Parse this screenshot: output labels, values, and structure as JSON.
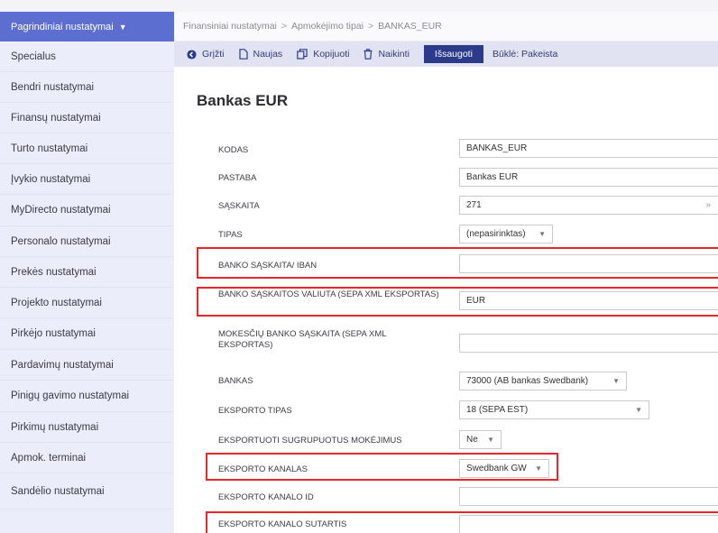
{
  "sidebar": {
    "header": "Pagrindiniai nustatymai",
    "items": [
      {
        "label": "Specialus"
      },
      {
        "label": "Bendri nustatymai"
      },
      {
        "label": "Finansų nustatymai"
      },
      {
        "label": "Turto nustatymai"
      },
      {
        "label": "Įvykio nustatymai"
      },
      {
        "label": "MyDirecto nustatymai"
      },
      {
        "label": "Personalo nustatymai"
      },
      {
        "label": "Prekės nustatymai"
      },
      {
        "label": "Projekto nustatymai"
      },
      {
        "label": "Pirkėjo nustatymai"
      },
      {
        "label": "Pardavimų nustatymai"
      },
      {
        "label": "Pinigų gavimo nustatymai"
      },
      {
        "label": "Pirkimų nustatymai"
      },
      {
        "label": "Apmok. terminai"
      },
      {
        "label": "Sandėlio nustatymai"
      }
    ]
  },
  "breadcrumb": [
    "Finansiniai nustatymai",
    "Apmokėjimo tipai",
    "BANKAS_EUR"
  ],
  "breadcrumb_sep": ">",
  "toolbar": {
    "back": "Grįžti",
    "new": "Naujas",
    "copy": "Kopijuoti",
    "delete": "Naikinti",
    "save": "Išsaugoti",
    "status": "Būklė: Pakeista"
  },
  "page_title": "Bankas EUR",
  "form": {
    "kodas": {
      "label": "KODAS",
      "value": "BANKAS_EUR"
    },
    "pastaba": {
      "label": "PASTABA",
      "value": "Bankas EUR"
    },
    "saskaita": {
      "label": "SĄSKAITA",
      "value": "271",
      "suffix": "»"
    },
    "tipas": {
      "label": "TIPAS",
      "value": "(nepasirinktas)"
    },
    "iban": {
      "label": "BANKO SĄSKAITA/ IBAN",
      "value": ""
    },
    "valiuta": {
      "label": "BANKO SĄSKAITOS VALIUTA (SEPA XML EKSPORTAS)",
      "value": "EUR"
    },
    "mokesciu": {
      "label": "MOKESČIŲ BANKO SĄSKAITA (SEPA XML EKSPORTAS)",
      "value": ""
    },
    "bankas": {
      "label": "BANKAS",
      "value": "73000 (AB bankas Swedbank)"
    },
    "eksporto_tipas": {
      "label": "EKSPORTO TIPAS",
      "value": "18 (SEPA EST)"
    },
    "sugrupuotus": {
      "label": "EKSPORTUOTI SUGRUPUOTUS MOKĖJIMUS",
      "value": "Ne"
    },
    "kanalas": {
      "label": "EKSPORTO KANALAS",
      "value": "Swedbank GW"
    },
    "kanalo_id": {
      "label": "EKSPORTO KANALO ID",
      "value": ""
    },
    "sutartis": {
      "label": "EKSPORTO KANALO SUTARTIS",
      "value": ""
    }
  },
  "colors": {
    "sidebar_header": "#5c6fd0",
    "sidebar_bg": "#ecedfa",
    "toolbar_bg": "#e1e3f3",
    "save_button": "#2c3a8c",
    "highlight": "#e4282c"
  },
  "icons": {
    "back": "arrow-left-circle-icon",
    "new": "document-icon",
    "copy": "copy-icon",
    "delete": "trash-icon",
    "sidebar_header": "chevron-down-icon",
    "saskaita_suffix": "double-chevron-right-icon",
    "select_arrow": "caret-down-icon"
  }
}
